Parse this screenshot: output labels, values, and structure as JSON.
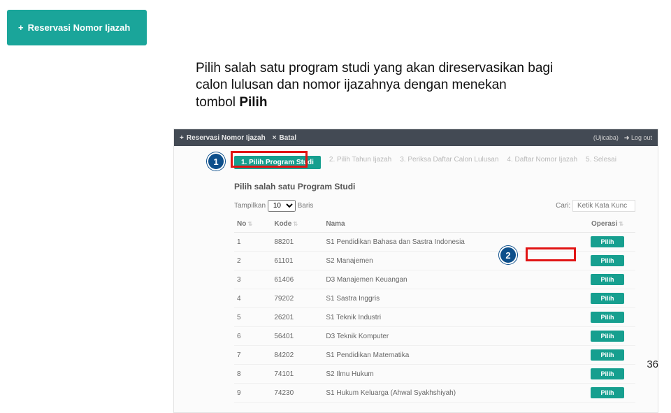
{
  "top_button": {
    "icon": "+",
    "label": "Reservasi Nomor Ijazah"
  },
  "instruction": {
    "line1": "Pilih salah satu program studi yang akan direservasikan bagi",
    "line2": "calon lulusan dan nomor ijazahnya dengan menekan",
    "line3a": "tombol ",
    "line3b": "Pilih"
  },
  "topbar": {
    "reserve": "Reservasi Nomor Ijazah",
    "batal": "Batal",
    "user": "(Ujicaba)",
    "logout": "Log out"
  },
  "steps": [
    "1. Pilih Program Studi",
    "2. Pilih Tahun Ijazah",
    "3. Periksa Daftar Calon Lulusan",
    "4. Daftar Nomor Ijazah",
    "5. Selesai"
  ],
  "section_title": "Pilih salah satu Program Studi",
  "toolbar": {
    "show_label": "Tampilkan",
    "show_value": "10",
    "rows_label": "Baris",
    "search_label": "Cari:",
    "search_placeholder": "Ketik Kata Kunc"
  },
  "columns": {
    "no": "No",
    "kode": "Kode",
    "nama": "Nama",
    "operasi": "Operasi"
  },
  "rows": [
    {
      "no": "1",
      "kode": "88201",
      "nama": "S1 Pendidikan Bahasa dan Sastra Indonesia"
    },
    {
      "no": "2",
      "kode": "61101",
      "nama": "S2 Manajemen"
    },
    {
      "no": "3",
      "kode": "61406",
      "nama": "D3 Manajemen Keuangan"
    },
    {
      "no": "4",
      "kode": "79202",
      "nama": "S1 Sastra Inggris"
    },
    {
      "no": "5",
      "kode": "26201",
      "nama": "S1 Teknik Industri"
    },
    {
      "no": "6",
      "kode": "56401",
      "nama": "D3 Teknik Komputer"
    },
    {
      "no": "7",
      "kode": "84202",
      "nama": "S1 Pendidikan Matematika"
    },
    {
      "no": "8",
      "kode": "74101",
      "nama": "S2 Ilmu Hukum"
    },
    {
      "no": "9",
      "kode": "74230",
      "nama": "S1 Hukum Keluarga (Ahwal Syakhshiyah)"
    }
  ],
  "pilih_label": "Pilih",
  "callouts": {
    "c1": "1",
    "c2": "2"
  },
  "page_number": "36"
}
